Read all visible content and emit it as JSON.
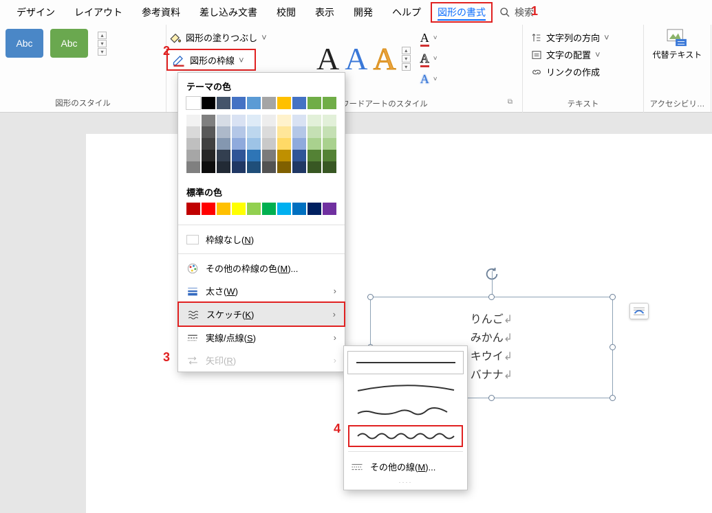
{
  "menu": {
    "items": [
      "デザイン",
      "レイアウト",
      "参考資料",
      "差し込み文書",
      "校閲",
      "表示",
      "開発",
      "ヘルプ",
      "図形の書式"
    ],
    "search": "検索"
  },
  "ribbon": {
    "shape_styles_label": "図形のスタイル",
    "thumb_text": "Abc",
    "fill": "図形の塗りつぶし",
    "outline": "図形の枠線",
    "wa_styles_label": "ワードアートのスタイル",
    "text_dir": "文字列の方向",
    "text_align": "文字の配置",
    "link_create": "リンクの作成",
    "text_label": "テキスト",
    "alt_text": "代替テキスト",
    "access_label": "アクセシビリ…"
  },
  "dropdown": {
    "theme_colors": "テーマの色",
    "std_colors": "標準の色",
    "no_outline": "枠線なし",
    "no_outline_u": "N",
    "more_colors": "その他の枠線の色",
    "more_colors_u": "M",
    "weight": "太さ",
    "weight_u": "W",
    "sketch": "スケッチ",
    "sketch_u": "K",
    "dashes": "実線/点線",
    "dashes_u": "S",
    "arrows": "矢印",
    "arrows_u": "R",
    "theme_row": [
      "#ffffff",
      "#000000",
      "#44546a",
      "#4472c4",
      "#5b9bd5",
      "#a5a5a5",
      "#ffc000",
      "#4472c4",
      "#70ad47",
      "#70ad47"
    ],
    "shades": [
      [
        "#f2f2f2",
        "#d9d9d9",
        "#bfbfbf",
        "#a6a6a6",
        "#808080"
      ],
      [
        "#7f7f7f",
        "#595959",
        "#404040",
        "#262626",
        "#0d0d0d"
      ],
      [
        "#d6dce5",
        "#adb9ca",
        "#8497b0",
        "#333f50",
        "#222a35"
      ],
      [
        "#d9e2f3",
        "#b4c7e7",
        "#8faadc",
        "#2f5597",
        "#203864"
      ],
      [
        "#deebf7",
        "#bdd7ee",
        "#9dc3e6",
        "#2e75b6",
        "#1f4e79"
      ],
      [
        "#ededed",
        "#dbdbdb",
        "#c9c9c9",
        "#7b7b7b",
        "#525252"
      ],
      [
        "#fff2cc",
        "#ffe699",
        "#ffd966",
        "#bf9000",
        "#806000"
      ],
      [
        "#d9e2f3",
        "#b4c7e7",
        "#8faadc",
        "#2f5597",
        "#203864"
      ],
      [
        "#e2f0d9",
        "#c5e0b4",
        "#a9d18e",
        "#548235",
        "#385723"
      ],
      [
        "#e2f0d9",
        "#c5e0b4",
        "#a9d18e",
        "#548235",
        "#385723"
      ]
    ],
    "std_row": [
      "#c00000",
      "#ff0000",
      "#ffc000",
      "#ffff00",
      "#92d050",
      "#00b050",
      "#00b0f0",
      "#0070c0",
      "#002060",
      "#7030a0"
    ]
  },
  "submenu": {
    "other_lines": "その他の線",
    "other_lines_u": "M"
  },
  "ann": {
    "a1": "1",
    "a2": "2",
    "a3": "3",
    "a4": "4"
  },
  "doc": {
    "lines": [
      "りんご",
      "みかん",
      "キウイ",
      "バナナ"
    ]
  }
}
